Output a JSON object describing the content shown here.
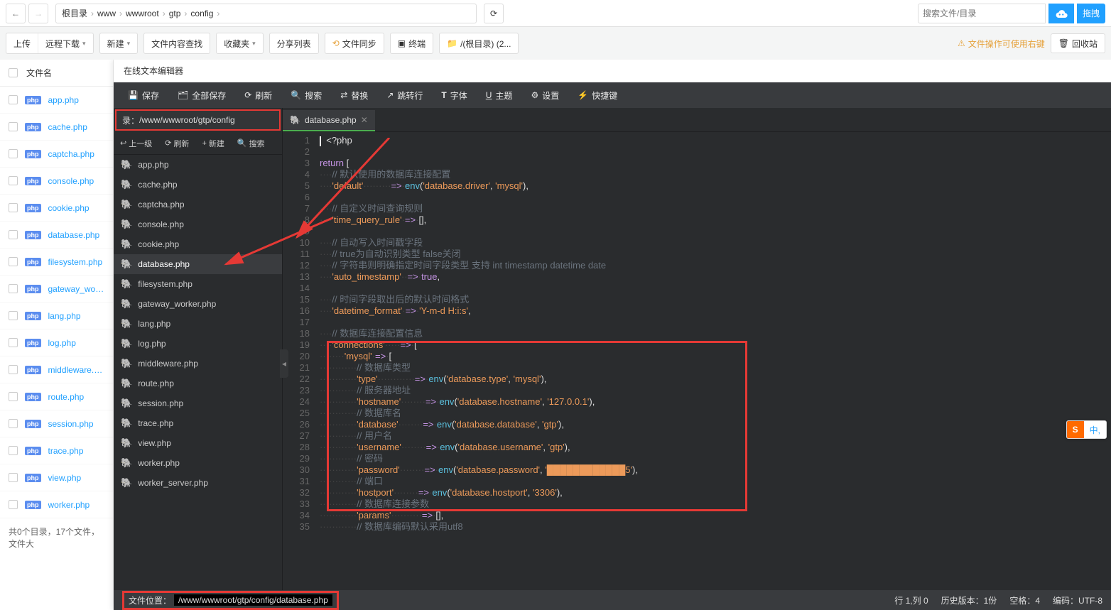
{
  "breadcrumb": {
    "items": [
      "根目录",
      "www",
      "wwwroot",
      "gtp",
      "config"
    ]
  },
  "top_search": {
    "placeholder": "搜索文件/目录",
    "button": "拖拽"
  },
  "toolbar": {
    "upload": "上传",
    "remote": "远程下载",
    "new": "新建",
    "content_search": "文件内容查找",
    "favorites": "收藏夹",
    "share": "分享列表",
    "sync": "文件同步",
    "terminal": "终端",
    "rootdir": "/(根目录) (2...",
    "warn": "文件操作可使用右键",
    "trash": "回收站"
  },
  "file_list": {
    "header": "文件名",
    "items": [
      "app.php",
      "cache.php",
      "captcha.php",
      "console.php",
      "cookie.php",
      "database.php",
      "filesystem.php",
      "gateway_worker.php",
      "lang.php",
      "log.php",
      "middleware.php",
      "route.php",
      "session.php",
      "trace.php",
      "view.php",
      "worker.php"
    ],
    "footer": "共0个目录，17个文件，文件大"
  },
  "editor": {
    "title": "在线文本编辑器",
    "menu": {
      "save": "保存",
      "save_all": "全部保存",
      "refresh": "刷新",
      "search": "搜索",
      "replace": "替换",
      "goto": "跳转行",
      "font": "字体",
      "theme": "主题",
      "settings": "设置",
      "shortcut": "快捷键"
    },
    "dir_label": "录：",
    "dir_path": "/www/wwwroot/gtp/config",
    "side_toolbar": {
      "up": "上一级",
      "refresh": "刷新",
      "new": "新建",
      "search": "搜索"
    },
    "side_files": [
      "app.php",
      "cache.php",
      "captcha.php",
      "console.php",
      "cookie.php",
      "database.php",
      "filesystem.php",
      "gateway_worker.php",
      "lang.php",
      "log.php",
      "middleware.php",
      "route.php",
      "session.php",
      "trace.php",
      "view.php",
      "worker.php",
      "worker_server.php"
    ],
    "active_file": "database.php",
    "tab": "database.php",
    "code_lines": [
      {
        "n": 1,
        "h": "<span class='hl-cursor'></span>  &lt;?php"
      },
      {
        "n": 2,
        "h": ""
      },
      {
        "n": 3,
        "h": "<span class='c-kw'>return</span> ["
      },
      {
        "n": 4,
        "h": "····<span class='c-cm'>// 默认使用的数据库连接配置</span>"
      },
      {
        "n": 5,
        "h": "····<span class='c-str'>'default'</span>·········<span class='c-arrow'>=&gt;</span>·<span class='c-fn'>env</span>(<span class='c-str'>'database.driver'</span>, <span class='c-str'>'mysql'</span>),"
      },
      {
        "n": 6,
        "h": ""
      },
      {
        "n": 7,
        "h": "····<span class='c-cm'>// 自定义时间查询规则</span>"
      },
      {
        "n": 8,
        "h": "····<span class='c-str'>'time_query_rule'</span>·<span class='c-arrow'>=&gt;</span>·[],"
      },
      {
        "n": 9,
        "h": ""
      },
      {
        "n": 10,
        "h": "····<span class='c-cm'>// 自动写入时间戳字段</span>"
      },
      {
        "n": 11,
        "h": "····<span class='c-cm'>// true为自动识别类型 false关闭</span>"
      },
      {
        "n": 12,
        "h": "····<span class='c-cm'>// 字符串则明确指定时间字段类型 支持 int timestamp datetime date</span>"
      },
      {
        "n": 13,
        "h": "····<span class='c-str'>'auto_timestamp'</span>··<span class='c-arrow'>=&gt;</span>·<span class='c-bool'>true</span>,"
      },
      {
        "n": 14,
        "h": ""
      },
      {
        "n": 15,
        "h": "····<span class='c-cm'>// 时间字段取出后的默认时间格式</span>"
      },
      {
        "n": 16,
        "h": "····<span class='c-str'>'datetime_format'</span>·<span class='c-arrow'>=&gt;</span>·<span class='c-str'>'Y-m-d H:i:s'</span>,"
      },
      {
        "n": 17,
        "h": ""
      },
      {
        "n": 18,
        "h": "····<span class='c-cm'>// 数据库连接配置信息</span>"
      },
      {
        "n": 19,
        "h": "····<span class='c-str'>'connections'</span>·····<span class='c-arrow'>=&gt;</span>·["
      },
      {
        "n": 20,
        "h": "········<span class='c-str'>'mysql'</span>·<span class='c-arrow'>=&gt;</span>·["
      },
      {
        "n": 21,
        "h": "············<span class='c-cm'>// 数据库类型</span>"
      },
      {
        "n": 22,
        "h": "············<span class='c-str'>'type'</span>············<span class='c-arrow'>=&gt;</span>·<span class='c-fn'>env</span>(<span class='c-str'>'database.type'</span>, <span class='c-str'>'mysql'</span>),"
      },
      {
        "n": 23,
        "h": "············<span class='c-cm'>// 服务器地址</span>"
      },
      {
        "n": 24,
        "h": "············<span class='c-str'>'hostname'</span>········<span class='c-arrow'>=&gt;</span>·<span class='c-fn'>env</span>(<span class='c-str'>'database.hostname'</span>, <span class='c-str'>'127.0.0.1'</span>),"
      },
      {
        "n": 25,
        "h": "············<span class='c-cm'>// 数据库名</span>"
      },
      {
        "n": 26,
        "h": "············<span class='c-str'>'database'</span>········<span class='c-arrow'>=&gt;</span>·<span class='c-fn'>env</span>(<span class='c-str'>'database.database'</span>, <span class='c-str'>'gtp'</span>),"
      },
      {
        "n": 27,
        "h": "············<span class='c-cm'>// 用户名</span>"
      },
      {
        "n": 28,
        "h": "············<span class='c-str'>'username'</span>········<span class='c-arrow'>=&gt;</span>·<span class='c-fn'>env</span>(<span class='c-str'>'database.username'</span>, <span class='c-str'>'gtp'</span>),"
      },
      {
        "n": 29,
        "h": "············<span class='c-cm'>// 密码</span>"
      },
      {
        "n": 30,
        "h": "············<span class='c-str'>'password'</span>········<span class='c-arrow'>=&gt;</span>·<span class='c-fn'>env</span>(<span class='c-str'>'database.password'</span>, <span class='c-str'>'████████████5'</span>),"
      },
      {
        "n": 31,
        "h": "············<span class='c-cm'>// 端口</span>"
      },
      {
        "n": 32,
        "h": "············<span class='c-str'>'hostport'</span>········<span class='c-arrow'>=&gt;</span>·<span class='c-fn'>env</span>(<span class='c-str'>'database.hostport'</span>, <span class='c-str'>'3306'</span>),"
      },
      {
        "n": 33,
        "h": "············<span class='c-cm'>// 数据库连接参数</span>"
      },
      {
        "n": 34,
        "h": "············<span class='c-str'>'params'</span>··········<span class='c-arrow'>=&gt;</span>·[],"
      },
      {
        "n": 35,
        "h": "············<span class='c-cm'>// 数据库编码默认采用utf8</span>"
      }
    ],
    "status": {
      "path_label": "文件位置：",
      "path": "/www/wwwroot/gtp/config/database.php",
      "cursor": "行 1,列 0",
      "history": "历史版本：1份",
      "indent": "空格：4",
      "encoding": "编码：UTF-8"
    }
  },
  "ime": {
    "logo": "S",
    "label": "中,"
  }
}
